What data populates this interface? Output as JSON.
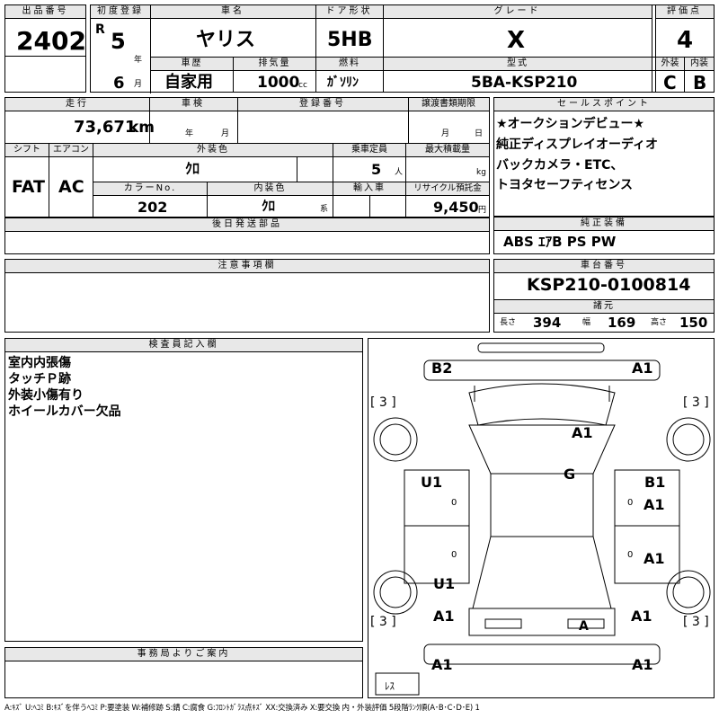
{
  "top": {
    "lot_label": "出品番号",
    "lot": "2402",
    "reg_label": "初度登録",
    "era": "R",
    "year": "5",
    "year_unit": "年",
    "month": "6",
    "month_unit": "月",
    "name_label": "車名",
    "name": "ヤリス",
    "door_label": "ドア形状",
    "door": "5HB",
    "grade_label": "グレード",
    "grade": "X",
    "score_label": "評価点",
    "score": "4",
    "history_label": "車歴",
    "history": "自家用",
    "disp_label": "排気量",
    "disp": "1000",
    "disp_unit": "cc",
    "fuel_label": "燃料",
    "fuel": "ｶﾞｿﾘﾝ",
    "model_label": "型式",
    "model": "5BA-KSP210",
    "ext_label": "外装",
    "ext": "C",
    "int_label": "内装",
    "int": "B"
  },
  "mid": {
    "mileage_label": "走行",
    "mileage": "73,671",
    "mileage_unit": "km",
    "inspection_label": "車検",
    "insp_year": "年",
    "insp_month": "月",
    "regno_label": "登録番号",
    "transfer_label": "譲渡書類期限",
    "tr_month": "月",
    "tr_day": "日",
    "shift_label": "シフト",
    "shift": "FAT",
    "ac_label": "エアコン",
    "ac": "AC",
    "color_label": "外装色",
    "color": "ｸﾛ",
    "seats_label": "乗車定員",
    "seats": "5",
    "seats_unit": "人",
    "load_label": "最大積載量",
    "load_unit": "kg",
    "colorno_label": "カラーNo.",
    "colorno": "202",
    "intcolor_label": "内装色",
    "intcolor": "ｸﾛ",
    "intcolor_unit": "系",
    "import_label": "輸入車",
    "recycle_label": "リサイクル預託金",
    "recycle": "9,450",
    "recycle_unit": "円",
    "later_label": "後日発送部品"
  },
  "sales": {
    "label": "セールスポイント",
    "lines": [
      "★オークションデビュー★",
      "純正ディスプレイオーディオ",
      "バックカメラ・ETC、",
      "トヨタセーフティセンス"
    ]
  },
  "equip": {
    "label": "純正装備",
    "value": "ABS ｴｱB PS PW"
  },
  "notes": {
    "label": "注意事項欄"
  },
  "chassis": {
    "label": "車台番号",
    "value": "KSP210-0100814",
    "spec_label": "諸元",
    "len_label": "長さ",
    "len": "394",
    "wid_label": "幅",
    "wid": "169",
    "hei_label": "高さ",
    "hei": "150"
  },
  "inspector": {
    "label": "検査員記入欄",
    "lines": [
      "室内内張傷",
      "タッチＰ跡",
      "外装小傷有り",
      "ホイールカバー欠品"
    ]
  },
  "office": {
    "label": "事務局よりご案内"
  },
  "diagram": {
    "marks": [
      "B2",
      "A1",
      "A1",
      "G",
      "U1",
      "B1",
      "A1",
      "A1",
      "U1",
      "A1",
      "A1",
      "A",
      "A1",
      "A1"
    ],
    "tires": [
      "3",
      "3",
      "3",
      "3"
    ],
    "spare": "ﾚｽ",
    "zeros": [
      "0",
      "0",
      "0",
      "0"
    ]
  },
  "legend": "A:ｷｽﾞ U:ﾍｺﾐ B:ｷｽﾞを伴うﾍｺﾐ P:要塗装 W:補修跡 S:錆 C:腐食 G:ﾌﾛﾝﾄｶﾞﾗｽ点ｷｽﾞ XX:交換済み X:要交換 内・外装評価 5段階ﾗﾝｸ順(A･B･C･D･E) 1"
}
